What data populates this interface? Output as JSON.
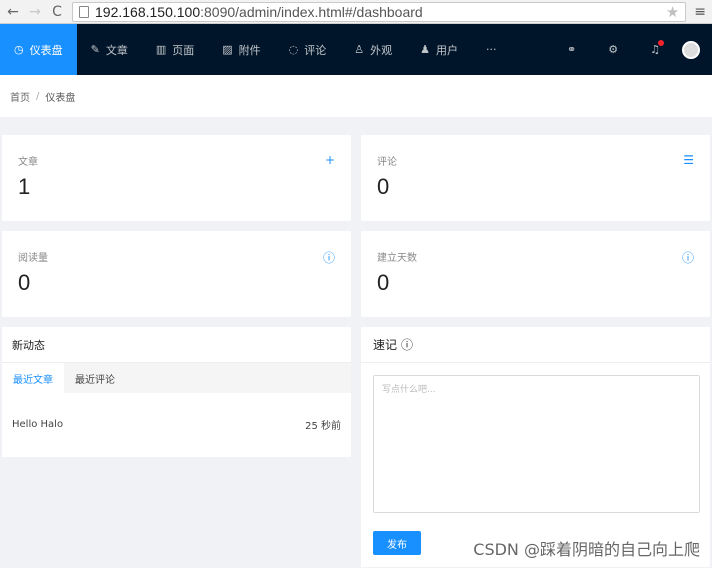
{
  "browser": {
    "back": "←",
    "forward": "→",
    "reload": "C",
    "url_host": "192.168.150.100",
    "url_rest": ":8090/admin/index.html#/dashboard",
    "star": "★",
    "menu": "≡"
  },
  "nav": {
    "items": [
      {
        "label": "仪表盘",
        "icon": "dashboard-icon",
        "glyph": "◷",
        "active": true
      },
      {
        "label": "文章",
        "icon": "edit-icon",
        "glyph": "✎"
      },
      {
        "label": "页面",
        "icon": "book-icon",
        "glyph": "▥"
      },
      {
        "label": "附件",
        "icon": "picture-icon",
        "glyph": "▨"
      },
      {
        "label": "评论",
        "icon": "comment-icon",
        "glyph": "◌"
      },
      {
        "label": "外观",
        "icon": "skin-icon",
        "glyph": "♙"
      },
      {
        "label": "用户",
        "icon": "user-icon",
        "glyph": "♟"
      }
    ],
    "more": "···",
    "link_glyph": "⚭",
    "settings_glyph": "⚙",
    "bell_glyph": "♫"
  },
  "breadcrumb": {
    "home": "首页",
    "sep": "/",
    "current": "仪表盘"
  },
  "stats": [
    {
      "label": "文章",
      "value": "1",
      "action": "+"
    },
    {
      "label": "评论",
      "value": "0",
      "action": "☰"
    },
    {
      "label": "阅读量",
      "value": "0",
      "action": "ⓘ"
    },
    {
      "label": "建立天数",
      "value": "0",
      "action": "ⓘ"
    }
  ],
  "news": {
    "title": "新动态",
    "tabs": [
      "最近文章",
      "最近评论"
    ],
    "posts": [
      {
        "title": "Hello Halo",
        "time": "25 秒前"
      }
    ]
  },
  "journal": {
    "title": "速记",
    "info": "ⓘ",
    "placeholder": "写点什么吧...",
    "submit": "发布"
  },
  "watermark": "CSDN @踩着阴暗的自己向上爬",
  "colors": {
    "accent": "#1890ff",
    "nav_bg": "#001529",
    "badge": "#f5222d"
  }
}
